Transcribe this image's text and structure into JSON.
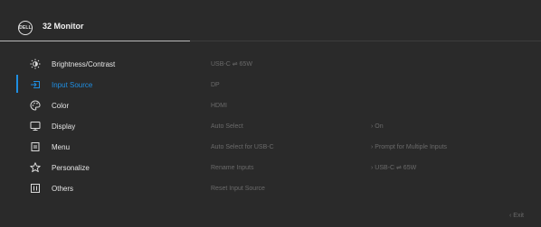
{
  "header": {
    "logo_text": "DELL",
    "title": "32 Monitor"
  },
  "menu": {
    "items": [
      {
        "label": "Brightness/Contrast",
        "icon": "brightness-icon"
      },
      {
        "label": "Input Source",
        "icon": "input-source-icon"
      },
      {
        "label": "Color",
        "icon": "palette-icon"
      },
      {
        "label": "Display",
        "icon": "monitor-icon"
      },
      {
        "label": "Menu",
        "icon": "menu-icon"
      },
      {
        "label": "Personalize",
        "icon": "star-icon"
      },
      {
        "label": "Others",
        "icon": "others-icon"
      }
    ],
    "active_index": 1
  },
  "options": {
    "items": [
      {
        "label": "USB-C ⇌ 65W",
        "value": ""
      },
      {
        "label": "DP",
        "value": ""
      },
      {
        "label": "HDMI",
        "value": ""
      },
      {
        "label": "Auto Select",
        "value": "› On"
      },
      {
        "label": "Auto Select for USB-C",
        "value": "› Prompt for Multiple Inputs"
      },
      {
        "label": "Rename Inputs",
        "value": "› USB-C ⇌ 65W"
      },
      {
        "label": "Reset Input Source",
        "value": ""
      }
    ]
  },
  "footer": {
    "exit_label": "‹ Exit"
  },
  "colors": {
    "background": "#2a2a2a",
    "accent": "#1f8fe3",
    "text": "#e6e6e6",
    "dim_text": "#6a6a6a"
  }
}
